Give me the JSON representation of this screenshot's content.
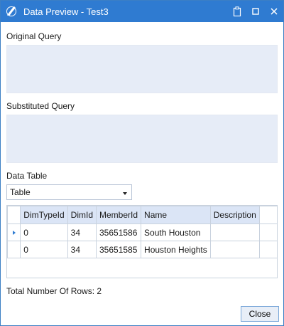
{
  "window": {
    "title": "Data Preview - Test3",
    "accent_color": "#2f7bd1",
    "controls": [
      "clipboard-icon",
      "maximize-icon",
      "close-icon"
    ]
  },
  "original_query": {
    "label": "Original Query",
    "value": ""
  },
  "substituted_query": {
    "label": "Substituted Query",
    "value": ""
  },
  "data_table": {
    "label": "Data Table",
    "selected": "Table",
    "columns": [
      "DimTypeId",
      "DimId",
      "MemberId",
      "Name",
      "Description"
    ],
    "rows": [
      [
        "0",
        "34",
        "35651586",
        "South Houston",
        ""
      ],
      [
        "0",
        "34",
        "35651585",
        "Houston Heights",
        ""
      ]
    ]
  },
  "total_rows_text": "Total Number Of Rows: 2",
  "close_label": "Close"
}
